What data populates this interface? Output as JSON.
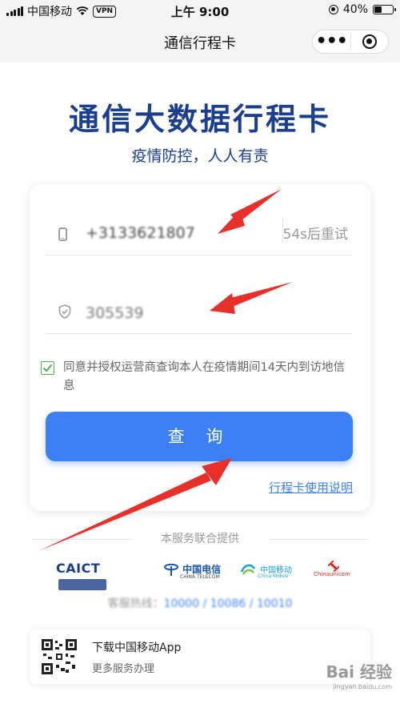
{
  "status_bar": {
    "carrier": "中国移动",
    "vpn": "VPN",
    "time": "上午 9:00",
    "battery": "40%"
  },
  "nav": {
    "title": "通信行程卡",
    "more_icon": "more-dots-icon",
    "close_icon": "target-close-icon"
  },
  "hero": {
    "title": "通信大数据行程卡",
    "subtitle": "疫情防控，人人有责"
  },
  "form": {
    "phone_value": "+3133621807",
    "resend_label": "54s后重试",
    "code_value": "305539",
    "agree_text": "同意并授权运营商查询本人在疫情期间14天内到访地信息",
    "agree_checked": true,
    "query_button": "查 询",
    "help_link": "行程卡使用说明"
  },
  "providers": {
    "heading": "本服务联合提供",
    "logos": [
      {
        "name": "CAICT",
        "text": "CAICT"
      },
      {
        "name": "china-telecom",
        "text": "中国电信",
        "sub": "CHINA TELECOM"
      },
      {
        "name": "china-mobile",
        "text": "中国移动",
        "sub": "China Mobile"
      },
      {
        "name": "china-unicom",
        "text": "China",
        "sub": "unicom"
      }
    ],
    "hotline_label": "客服热线：",
    "hotline_numbers": "10000 / 10086 / 10010"
  },
  "banner": {
    "title": "下载中国移动App",
    "subtitle": "更多服务办理"
  },
  "watermark": {
    "text": "Bai 经验",
    "sub": "jingyan.baidu.com"
  },
  "colors": {
    "brand_navy": "#1b3e8f",
    "primary_blue": "#3d80f6",
    "check_green": "#4caf50",
    "arrow_red": "#e8302b"
  }
}
